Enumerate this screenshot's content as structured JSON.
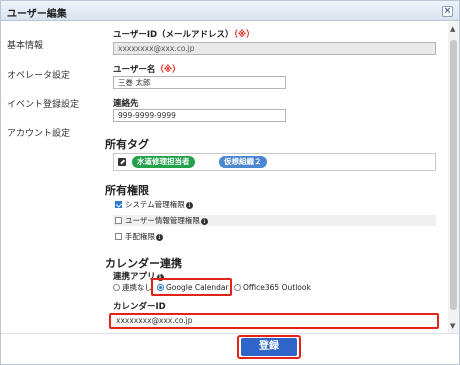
{
  "dialog": {
    "title": "ユーザー編集",
    "close_label": "×"
  },
  "sidebar": {
    "items": [
      {
        "label": "基本情報"
      },
      {
        "label": "オペレータ設定"
      },
      {
        "label": "イベント登録設定"
      },
      {
        "label": "アカウント設定"
      }
    ]
  },
  "form": {
    "userid": {
      "label": "ユーザーID（メールアドレス）",
      "required": "（※）",
      "value": "xxxxxxxx@xxx.co.jp"
    },
    "username": {
      "label": "ユーザー名",
      "required": "（※）",
      "value": "三巻 太郎"
    },
    "contact": {
      "label": "連絡先",
      "value": "999-9999-9999"
    },
    "tags": {
      "heading": "所有タグ",
      "items": [
        "水道修理担当者",
        "仮想組織２"
      ]
    },
    "permissions": {
      "heading": "所有権限",
      "items": [
        {
          "label": "システム管理権限",
          "checked": true
        },
        {
          "label": "ユーザー情報管理権限",
          "checked": false
        },
        {
          "label": "手配権限",
          "checked": false
        }
      ]
    },
    "calendar": {
      "heading": "カレンダー連携",
      "app_label": "連携アプリ",
      "options": [
        {
          "label": "連携なし",
          "selected": false
        },
        {
          "label": "Google Calendar",
          "selected": true
        },
        {
          "label": "Office365 Outlook",
          "selected": false
        }
      ],
      "id_label": "カレンダーID",
      "id_value": "xxxxxxxx@xxx.co.jp"
    }
  },
  "footer": {
    "register_label": "登録"
  },
  "colors": {
    "accent": "#2f64c9",
    "required": "#e2231a",
    "tag_green": "#23a04a",
    "tag_blue": "#4b86d0"
  }
}
